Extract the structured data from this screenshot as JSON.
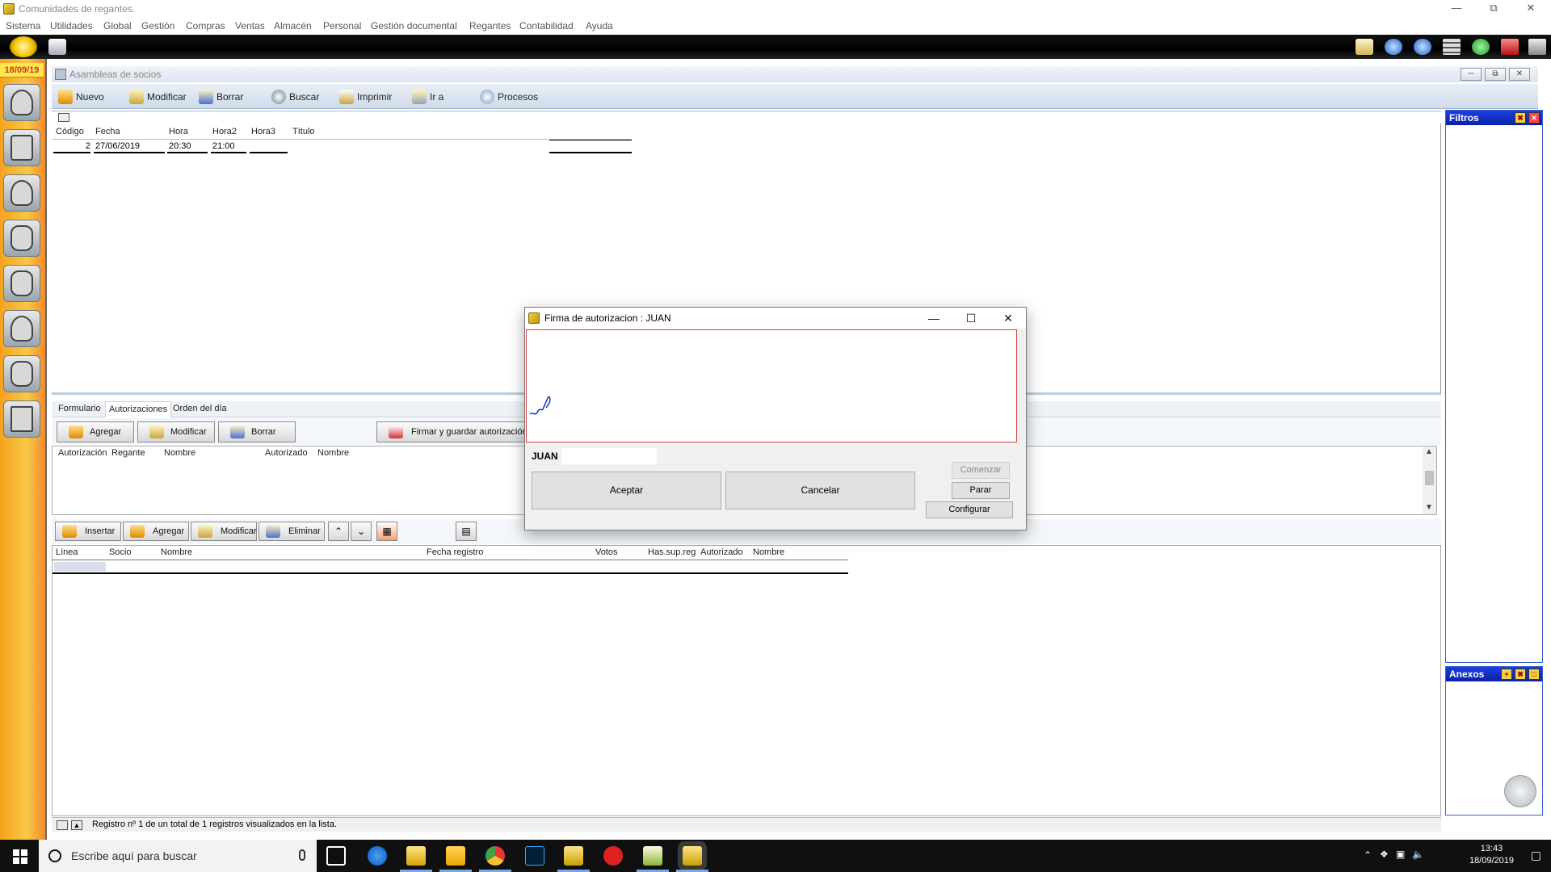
{
  "window": {
    "title": "Comunidades de regantes."
  },
  "menu": [
    "Sistema",
    "Utilidades",
    "Global",
    "Gestión",
    "Compras",
    "Ventas",
    "Almacén",
    "Personal",
    "Gestión documental",
    "Regantes",
    "Contabilidad",
    "Ayuda"
  ],
  "sidebar": {
    "date": "18/09/19"
  },
  "child": {
    "title": "Asambleas de socios",
    "toolbar": [
      "Nuevo",
      "Modificar",
      "Borrar",
      "Buscar",
      "Imprimir",
      "Ir a",
      "Procesos"
    ]
  },
  "upper_grid": {
    "headers": [
      "Código",
      "Fecha",
      "Hora",
      "Hora2",
      "Hora3",
      "Título"
    ],
    "rows": [
      {
        "codigo": "2",
        "fecha": "27/06/2019",
        "hora": "20:30",
        "hora2": "21:00",
        "hora3": "",
        "titulo": ""
      }
    ]
  },
  "panels": {
    "filtros": "Filtros",
    "anexos": "Anexos"
  },
  "tabs": [
    "Formulario",
    "Autorizaciones",
    "Orden del día"
  ],
  "auth_toolbar": {
    "add": "Agregar",
    "modify": "Modificar",
    "delete": "Borrar",
    "sign": "Firmar y guardar autorización"
  },
  "auth_grid": {
    "headers": [
      "Autorización",
      "Regante",
      "Nombre",
      "Autorizado",
      "Nombre"
    ]
  },
  "line_toolbar": {
    "insert": "Insertar",
    "add": "Agregar",
    "modify": "Modificar",
    "remove": "Eliminar"
  },
  "lower_grid": {
    "headers": [
      "Línea",
      "Socio",
      "Nombre",
      "Fecha registro",
      "Votos",
      "Has.sup.reg",
      "Autorizado",
      "Nombre"
    ]
  },
  "status": {
    "text": "Registro nº 1 de un total de 1 registros visualizados en la lista."
  },
  "dialog": {
    "title": "Firma de autorizacion : JUAN",
    "name": "JUAN",
    "input_value": "",
    "accept": "Aceptar",
    "cancel": "Cancelar",
    "start": "Comenzar",
    "stop": "Parar",
    "configure": "Configurar"
  },
  "taskbar": {
    "search_placeholder": "Escribe aquí para buscar",
    "time": "13:43",
    "date": "18/09/2019"
  }
}
